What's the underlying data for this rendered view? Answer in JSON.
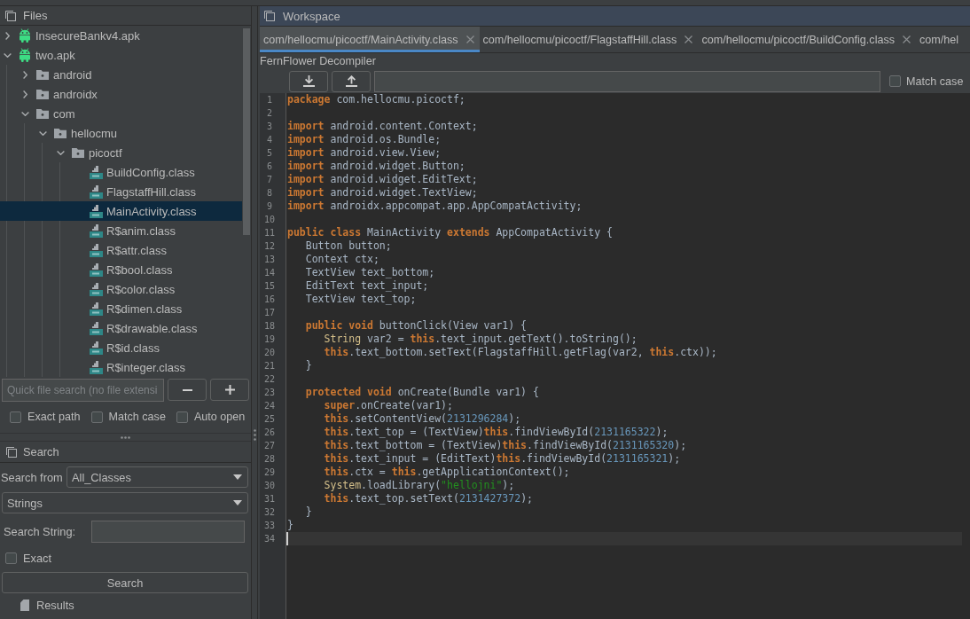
{
  "files_panel": {
    "title": "Files",
    "tree": [
      {
        "label": "InsecureBankv4.apk",
        "kind": "apk",
        "expanded": false,
        "selected": false
      },
      {
        "label": "two.apk",
        "kind": "apk",
        "expanded": true,
        "selected": false,
        "children": [
          {
            "label": "android",
            "kind": "folder",
            "expanded": false,
            "selected": false
          },
          {
            "label": "androidx",
            "kind": "folder",
            "expanded": false,
            "selected": false
          },
          {
            "label": "com",
            "kind": "folder",
            "expanded": true,
            "selected": false,
            "children": [
              {
                "label": "hellocmu",
                "kind": "folder",
                "expanded": true,
                "selected": false,
                "children": [
                  {
                    "label": "picoctf",
                    "kind": "folder",
                    "expanded": true,
                    "selected": false,
                    "children": [
                      {
                        "label": "BuildConfig.class",
                        "kind": "class",
                        "selected": false
                      },
                      {
                        "label": "FlagstaffHill.class",
                        "kind": "class",
                        "selected": false
                      },
                      {
                        "label": "MainActivity.class",
                        "kind": "class",
                        "selected": true
                      },
                      {
                        "label": "R$anim.class",
                        "kind": "class",
                        "selected": false
                      },
                      {
                        "label": "R$attr.class",
                        "kind": "class",
                        "selected": false
                      },
                      {
                        "label": "R$bool.class",
                        "kind": "class",
                        "selected": false
                      },
                      {
                        "label": "R$color.class",
                        "kind": "class",
                        "selected": false
                      },
                      {
                        "label": "R$dimen.class",
                        "kind": "class",
                        "selected": false
                      },
                      {
                        "label": "R$drawable.class",
                        "kind": "class",
                        "selected": false
                      },
                      {
                        "label": "R$id.class",
                        "kind": "class",
                        "selected": false
                      },
                      {
                        "label": "R$integer.class",
                        "kind": "class",
                        "selected": false
                      }
                    ]
                  }
                ]
              }
            ]
          }
        ]
      }
    ],
    "quick_search": {
      "placeholder": "Quick file search (no file extensi"
    },
    "options": [
      {
        "label": "Exact path",
        "checked": false
      },
      {
        "label": "Match case",
        "checked": false
      },
      {
        "label": "Auto open",
        "checked": false
      }
    ]
  },
  "search_panel": {
    "title": "Search",
    "search_from": {
      "label": "Search from",
      "value": "All_Classes"
    },
    "search_type": {
      "value": "Strings"
    },
    "search_string": {
      "label": "Search String:"
    },
    "exact": {
      "label": "Exact",
      "checked": false
    },
    "search_button": "Search",
    "results": {
      "label": "Results"
    }
  },
  "workspace": {
    "title": "Workspace",
    "tabs": [
      {
        "label": "com/hellocmu/picoctf/MainActivity.class",
        "selected": true,
        "closable": true
      },
      {
        "label": "com/hellocmu/picoctf/FlagstaffHill.class",
        "selected": false,
        "closable": true
      },
      {
        "label": "com/hellocmu/picoctf/BuildConfig.class",
        "selected": false,
        "closable": true
      },
      {
        "label": "com/hel",
        "selected": false,
        "closable": false
      }
    ],
    "decompiler": "FernFlower Decompiler",
    "match_case": {
      "label": "Match case",
      "checked": false
    },
    "code": [
      {
        "number": "1",
        "current": false,
        "tokens": [
          {
            "kind": "keyword",
            "text": "package"
          },
          {
            "kind": "plain",
            "text": " com.hellocmu.picoctf;"
          }
        ]
      },
      {
        "number": "2",
        "current": false
      },
      {
        "number": "3",
        "current": false,
        "tokens": [
          {
            "kind": "keyword",
            "text": "import"
          },
          {
            "kind": "plain",
            "text": " android.content.Context;"
          }
        ]
      },
      {
        "number": "4",
        "current": false,
        "tokens": [
          {
            "kind": "keyword",
            "text": "import"
          },
          {
            "kind": "plain",
            "text": " android.os.Bundle;"
          }
        ]
      },
      {
        "number": "5",
        "current": false,
        "tokens": [
          {
            "kind": "keyword",
            "text": "import"
          },
          {
            "kind": "plain",
            "text": " android.view.View;"
          }
        ]
      },
      {
        "number": "6",
        "current": false,
        "tokens": [
          {
            "kind": "keyword",
            "text": "import"
          },
          {
            "kind": "plain",
            "text": " android.widget.Button;"
          }
        ]
      },
      {
        "number": "7",
        "current": false,
        "tokens": [
          {
            "kind": "keyword",
            "text": "import"
          },
          {
            "kind": "plain",
            "text": " android.widget.EditText;"
          }
        ]
      },
      {
        "number": "8",
        "current": false,
        "tokens": [
          {
            "kind": "keyword",
            "text": "import"
          },
          {
            "kind": "plain",
            "text": " android.widget.TextView;"
          }
        ]
      },
      {
        "number": "9",
        "current": false,
        "tokens": [
          {
            "kind": "keyword",
            "text": "import"
          },
          {
            "kind": "plain",
            "text": " androidx.appcompat.app.AppCompatActivity;"
          }
        ]
      },
      {
        "number": "10",
        "current": false
      },
      {
        "number": "11",
        "current": false,
        "tokens": [
          {
            "kind": "keyword",
            "text": "public"
          },
          {
            "kind": "keyword",
            "text": " class"
          },
          {
            "kind": "plain",
            "text": " MainActivity "
          },
          {
            "kind": "keyword",
            "text": "extends"
          },
          {
            "kind": "plain",
            "text": " AppCompatActivity {"
          }
        ]
      },
      {
        "number": "12",
        "current": false,
        "tokens": [
          {
            "kind": "plain",
            "text": "   Button button;"
          }
        ]
      },
      {
        "number": "13",
        "current": false,
        "tokens": [
          {
            "kind": "plain",
            "text": "   Context ctx;"
          }
        ]
      },
      {
        "number": "14",
        "current": false,
        "tokens": [
          {
            "kind": "plain",
            "text": "   TextView text_bottom;"
          }
        ]
      },
      {
        "number": "15",
        "current": false,
        "tokens": [
          {
            "kind": "plain",
            "text": "   EditText text_input;"
          }
        ]
      },
      {
        "number": "16",
        "current": false,
        "tokens": [
          {
            "kind": "plain",
            "text": "   TextView text_top;"
          }
        ]
      },
      {
        "number": "17",
        "current": false
      },
      {
        "number": "18",
        "current": false,
        "tokens": [
          {
            "kind": "keyword",
            "text": "   public"
          },
          {
            "kind": "keyword",
            "text": " void"
          },
          {
            "kind": "plain",
            "text": " buttonClick(View var1) {"
          }
        ]
      },
      {
        "number": "19",
        "current": false,
        "tokens": [
          {
            "kind": "type",
            "text": "      String"
          },
          {
            "kind": "plain",
            "text": " var2 = "
          },
          {
            "kind": "keyword",
            "text": "this"
          },
          {
            "kind": "plain",
            "text": ".text_input.getText().toString();"
          }
        ]
      },
      {
        "number": "20",
        "current": false,
        "tokens": [
          {
            "kind": "keyword",
            "text": "      this"
          },
          {
            "kind": "plain",
            "text": ".text_bottom.setText(FlagstaffHill.getFlag(var2, "
          },
          {
            "kind": "keyword",
            "text": "this"
          },
          {
            "kind": "plain",
            "text": ".ctx));"
          }
        ]
      },
      {
        "number": "21",
        "current": false,
        "tokens": [
          {
            "kind": "plain",
            "text": "   }"
          }
        ]
      },
      {
        "number": "22",
        "current": false
      },
      {
        "number": "23",
        "current": false,
        "tokens": [
          {
            "kind": "keyword",
            "text": "   protected"
          },
          {
            "kind": "keyword",
            "text": " void"
          },
          {
            "kind": "plain",
            "text": " onCreate(Bundle var1) {"
          }
        ]
      },
      {
        "number": "24",
        "current": false,
        "tokens": [
          {
            "kind": "keyword",
            "text": "      super"
          },
          {
            "kind": "plain",
            "text": ".onCreate(var1);"
          }
        ]
      },
      {
        "number": "25",
        "current": false,
        "tokens": [
          {
            "kind": "keyword",
            "text": "      this"
          },
          {
            "kind": "plain",
            "text": ".setContentView("
          },
          {
            "kind": "number",
            "text": "2131296284"
          },
          {
            "kind": "plain",
            "text": ");"
          }
        ]
      },
      {
        "number": "26",
        "current": false,
        "tokens": [
          {
            "kind": "keyword",
            "text": "      this"
          },
          {
            "kind": "plain",
            "text": ".text_top = (TextView)"
          },
          {
            "kind": "keyword",
            "text": "this"
          },
          {
            "kind": "plain",
            "text": ".findViewById("
          },
          {
            "kind": "number",
            "text": "2131165322"
          },
          {
            "kind": "plain",
            "text": ");"
          }
        ]
      },
      {
        "number": "27",
        "current": false,
        "tokens": [
          {
            "kind": "keyword",
            "text": "      this"
          },
          {
            "kind": "plain",
            "text": ".text_bottom = (TextView)"
          },
          {
            "kind": "keyword",
            "text": "this"
          },
          {
            "kind": "plain",
            "text": ".findViewById("
          },
          {
            "kind": "number",
            "text": "2131165320"
          },
          {
            "kind": "plain",
            "text": ");"
          }
        ]
      },
      {
        "number": "28",
        "current": false,
        "tokens": [
          {
            "kind": "keyword",
            "text": "      this"
          },
          {
            "kind": "plain",
            "text": ".text_input = (EditText)"
          },
          {
            "kind": "keyword",
            "text": "this"
          },
          {
            "kind": "plain",
            "text": ".findViewById("
          },
          {
            "kind": "number",
            "text": "2131165321"
          },
          {
            "kind": "plain",
            "text": ");"
          }
        ]
      },
      {
        "number": "29",
        "current": false,
        "tokens": [
          {
            "kind": "keyword",
            "text": "      this"
          },
          {
            "kind": "plain",
            "text": ".ctx = "
          },
          {
            "kind": "keyword",
            "text": "this"
          },
          {
            "kind": "plain",
            "text": ".getApplicationContext();"
          }
        ]
      },
      {
        "number": "30",
        "current": false,
        "tokens": [
          {
            "kind": "type",
            "text": "      System"
          },
          {
            "kind": "plain",
            "text": ".loadLibrary("
          },
          {
            "kind": "string",
            "text": "\"hellojni\""
          },
          {
            "kind": "plain",
            "text": ");"
          }
        ]
      },
      {
        "number": "31",
        "current": false,
        "tokens": [
          {
            "kind": "keyword",
            "text": "      this"
          },
          {
            "kind": "plain",
            "text": ".text_top.setText("
          },
          {
            "kind": "number",
            "text": "2131427372"
          },
          {
            "kind": "plain",
            "text": ");"
          }
        ]
      },
      {
        "number": "32",
        "current": false,
        "tokens": [
          {
            "kind": "plain",
            "text": "   }"
          }
        ]
      },
      {
        "number": "33",
        "current": false,
        "tokens": [
          {
            "kind": "plain",
            "text": "}"
          }
        ]
      },
      {
        "number": "34",
        "current": true
      }
    ]
  }
}
